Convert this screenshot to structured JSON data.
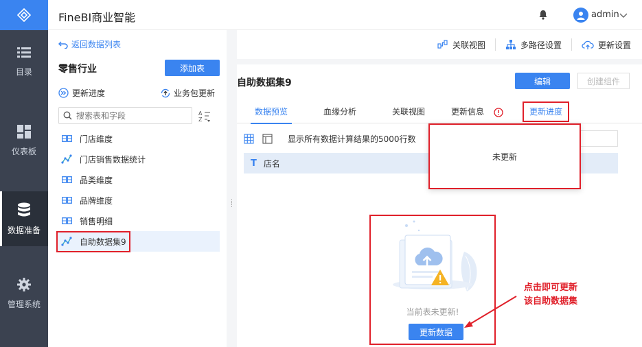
{
  "header": {
    "app_title": "FineBI商业智能",
    "username": "admin"
  },
  "rail": {
    "items": [
      {
        "label": "目录",
        "icon": "list-icon"
      },
      {
        "label": "仪表板",
        "icon": "dashboard-icon"
      },
      {
        "label": "数据准备",
        "icon": "database-icon"
      },
      {
        "label": "管理系统",
        "icon": "gear-icon"
      }
    ]
  },
  "left": {
    "back_label": "返回数据列表",
    "package_title": "零售行业",
    "add_table_label": "添加表",
    "progress_label": "更新进度",
    "package_update_label": "业务包更新",
    "search_placeholder": "搜索表和字段",
    "tables": [
      {
        "label": "门店维度",
        "icon": "db-table-icon"
      },
      {
        "label": "门店销售数据统计",
        "icon": "self-dataset-icon"
      },
      {
        "label": "品类维度",
        "icon": "db-table-icon"
      },
      {
        "label": "品牌维度",
        "icon": "db-table-icon"
      },
      {
        "label": "销售明细",
        "icon": "db-table-icon"
      },
      {
        "label": "自助数据集9",
        "icon": "self-dataset-icon"
      }
    ]
  },
  "toolbar": {
    "relation_view": "关联视图",
    "multipath": "多路径设置",
    "update_settings": "更新设置"
  },
  "main": {
    "dataset_title": "自助数据集9",
    "edit_label": "编辑",
    "create_component_label": "创建组件",
    "tabs": [
      {
        "label": "数据预览",
        "active": true
      },
      {
        "label": "血缘分析",
        "active": false
      },
      {
        "label": "关联视图",
        "active": false
      },
      {
        "label": "更新信息",
        "active": false
      },
      {
        "label": "更新进度",
        "active": false
      }
    ],
    "preview_note": "显示所有数据计算结果的5000行数",
    "column_type": "T",
    "column_name": "店名",
    "popup_text": "未更新",
    "empty_text": "当前表未更新!",
    "update_data_label": "更新数据"
  },
  "annotation": {
    "line1": "点击即可更新",
    "line2": "该自助数据集"
  },
  "colors": {
    "accent": "#3a84f0",
    "rail": "#3b4250",
    "highlight": "#e0202a"
  }
}
